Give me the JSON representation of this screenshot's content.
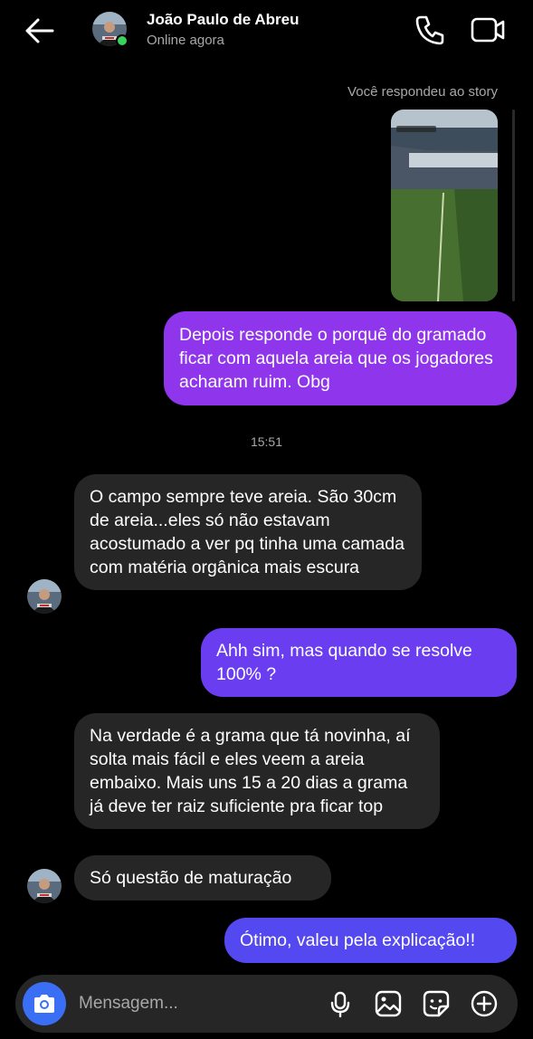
{
  "header": {
    "name": "João Paulo de Abreu",
    "status": "Online agora"
  },
  "story": {
    "note": "Você respondeu ao story"
  },
  "messages": [
    {
      "sender": "me",
      "text": "Depois responde o porquê do gramado ficar com aquela areia que os jogadores acharam ruim. Obg"
    },
    {
      "sender": "contact",
      "text": "O campo sempre teve areia. São 30cm de areia...eles só não estavam acostumado a ver pq tinha uma camada com matéria orgânica mais escura"
    },
    {
      "sender": "me",
      "text": "Ahh sim, mas quando se resolve 100% ?"
    },
    {
      "sender": "contact",
      "text": "Na verdade é a grama que tá novinha, aí solta mais fácil e eles veem a areia embaixo. Mais uns 15 a 20 dias a grama já deve ter raiz suficiente pra ficar top"
    },
    {
      "sender": "contact",
      "text": "Só questão de maturação"
    },
    {
      "sender": "me",
      "text": "Ótimo, valeu pela explicação!!"
    }
  ],
  "timestamp": "15:51",
  "composer": {
    "placeholder": "Mensagem..."
  },
  "colors": {
    "outgoing_bubble": "#8f35ec",
    "incoming_bubble": "#262626",
    "online": "#3ad15c",
    "camera_button": "#3a6ff5"
  },
  "icons": [
    "back-arrow-icon",
    "phone-icon",
    "video-camera-icon",
    "camera-icon",
    "microphone-icon",
    "gallery-icon",
    "sticker-icon",
    "plus-icon"
  ]
}
